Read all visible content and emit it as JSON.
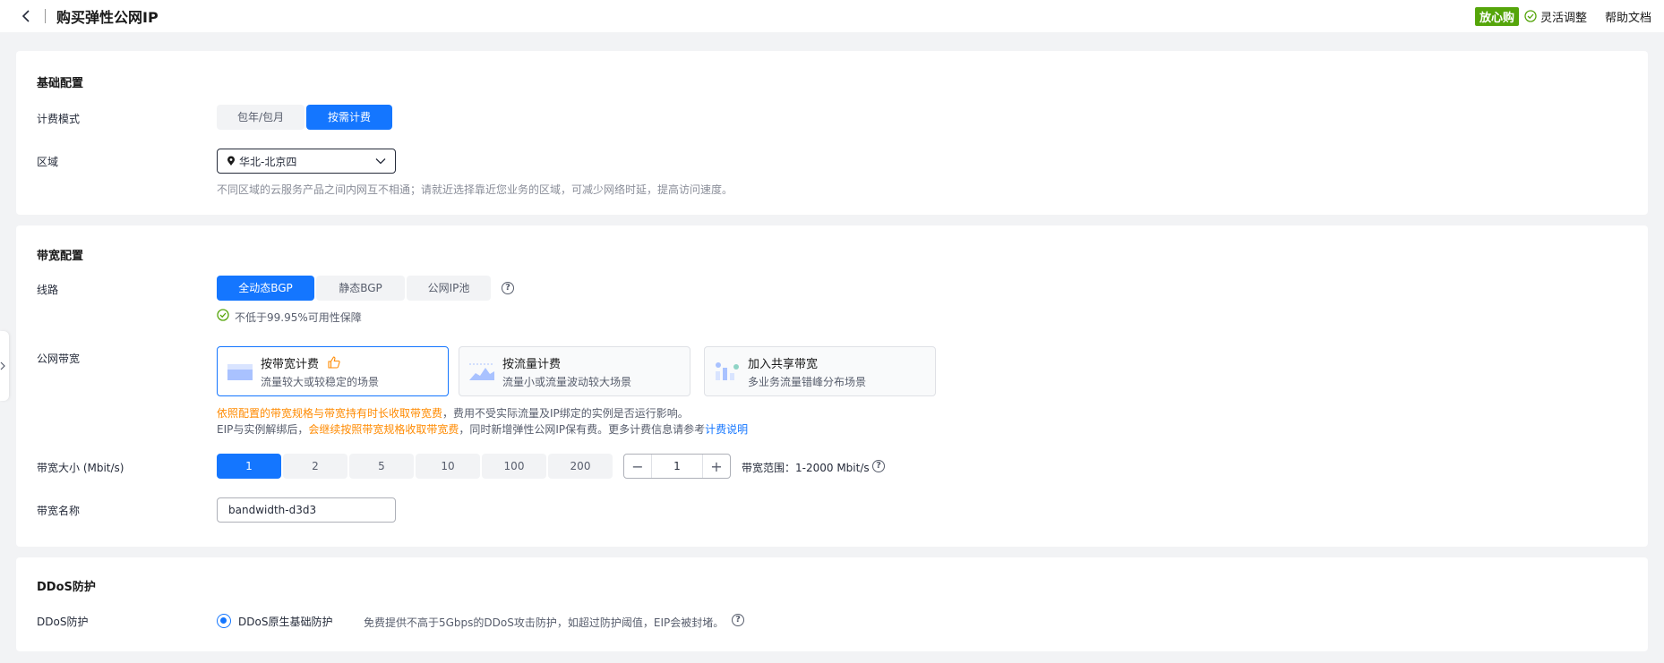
{
  "header": {
    "title": "购买弹性公网IP",
    "badge": "放心购",
    "flex_label": "灵活调整",
    "help": "帮助文档"
  },
  "basic": {
    "title": "基础配置",
    "billing_label": "计费模式",
    "billing_options": [
      "包年/包月",
      "按需计费"
    ],
    "billing_selected": "按需计费",
    "region_label": "区域",
    "region_value": "华北-北京四",
    "region_hint": "不同区域的云服务产品之间内网互不相通；请就近选择靠近您业务的区域，可减少网络时延，提高访问速度。"
  },
  "bandwidth": {
    "title": "带宽配置",
    "line_label": "线路",
    "line_options": [
      "全动态BGP",
      "静态BGP",
      "公网IP池"
    ],
    "line_selected": "全动态BGP",
    "availability": "不低于99.95%可用性保障",
    "public_bw_label": "公网带宽",
    "billing_cards": [
      {
        "title": "按带宽计费",
        "desc": "流量较大或较稳定的场景",
        "icon": "thumbs-up-icon"
      },
      {
        "title": "按流量计费",
        "desc": "流量小或流量波动较大场景"
      },
      {
        "title": "加入共享带宽",
        "desc": "多业务流量错峰分布场景"
      }
    ],
    "note1_orange": "依照配置的带宽规格与带宽持有时长收取带宽费",
    "note1_rest": "，费用不受实际流量及IP绑定的实例是否运行影响。",
    "note2_a": "EIP与实例解绑后，",
    "note2_orange": "会继续按照带宽规格收取带宽费",
    "note2_b": "，同时新增弹性公网IP保有费。更多计费信息请参考",
    "note2_link": "计费说明",
    "size_label": "带宽大小 (Mbit/s)",
    "size_options": [
      "1",
      "2",
      "5",
      "10",
      "100",
      "200"
    ],
    "size_selected": "1",
    "stepper_minus": "−",
    "stepper_value": "1",
    "stepper_plus": "+",
    "range_text": "带宽范围：1-2000 Mbit/s",
    "name_label": "带宽名称",
    "name_value": "bandwidth-d3d3"
  },
  "ddos": {
    "title": "DDoS防护",
    "label": "DDoS防护",
    "option": "DDoS原生基础防护",
    "desc": "免费提供不高于5Gbps的DDoS攻击防护，如超过防护阈值，EIP会被封堵。"
  },
  "colors": {
    "primary": "#1476ff",
    "orange": "#ff8a00",
    "green": "#55a50a"
  }
}
